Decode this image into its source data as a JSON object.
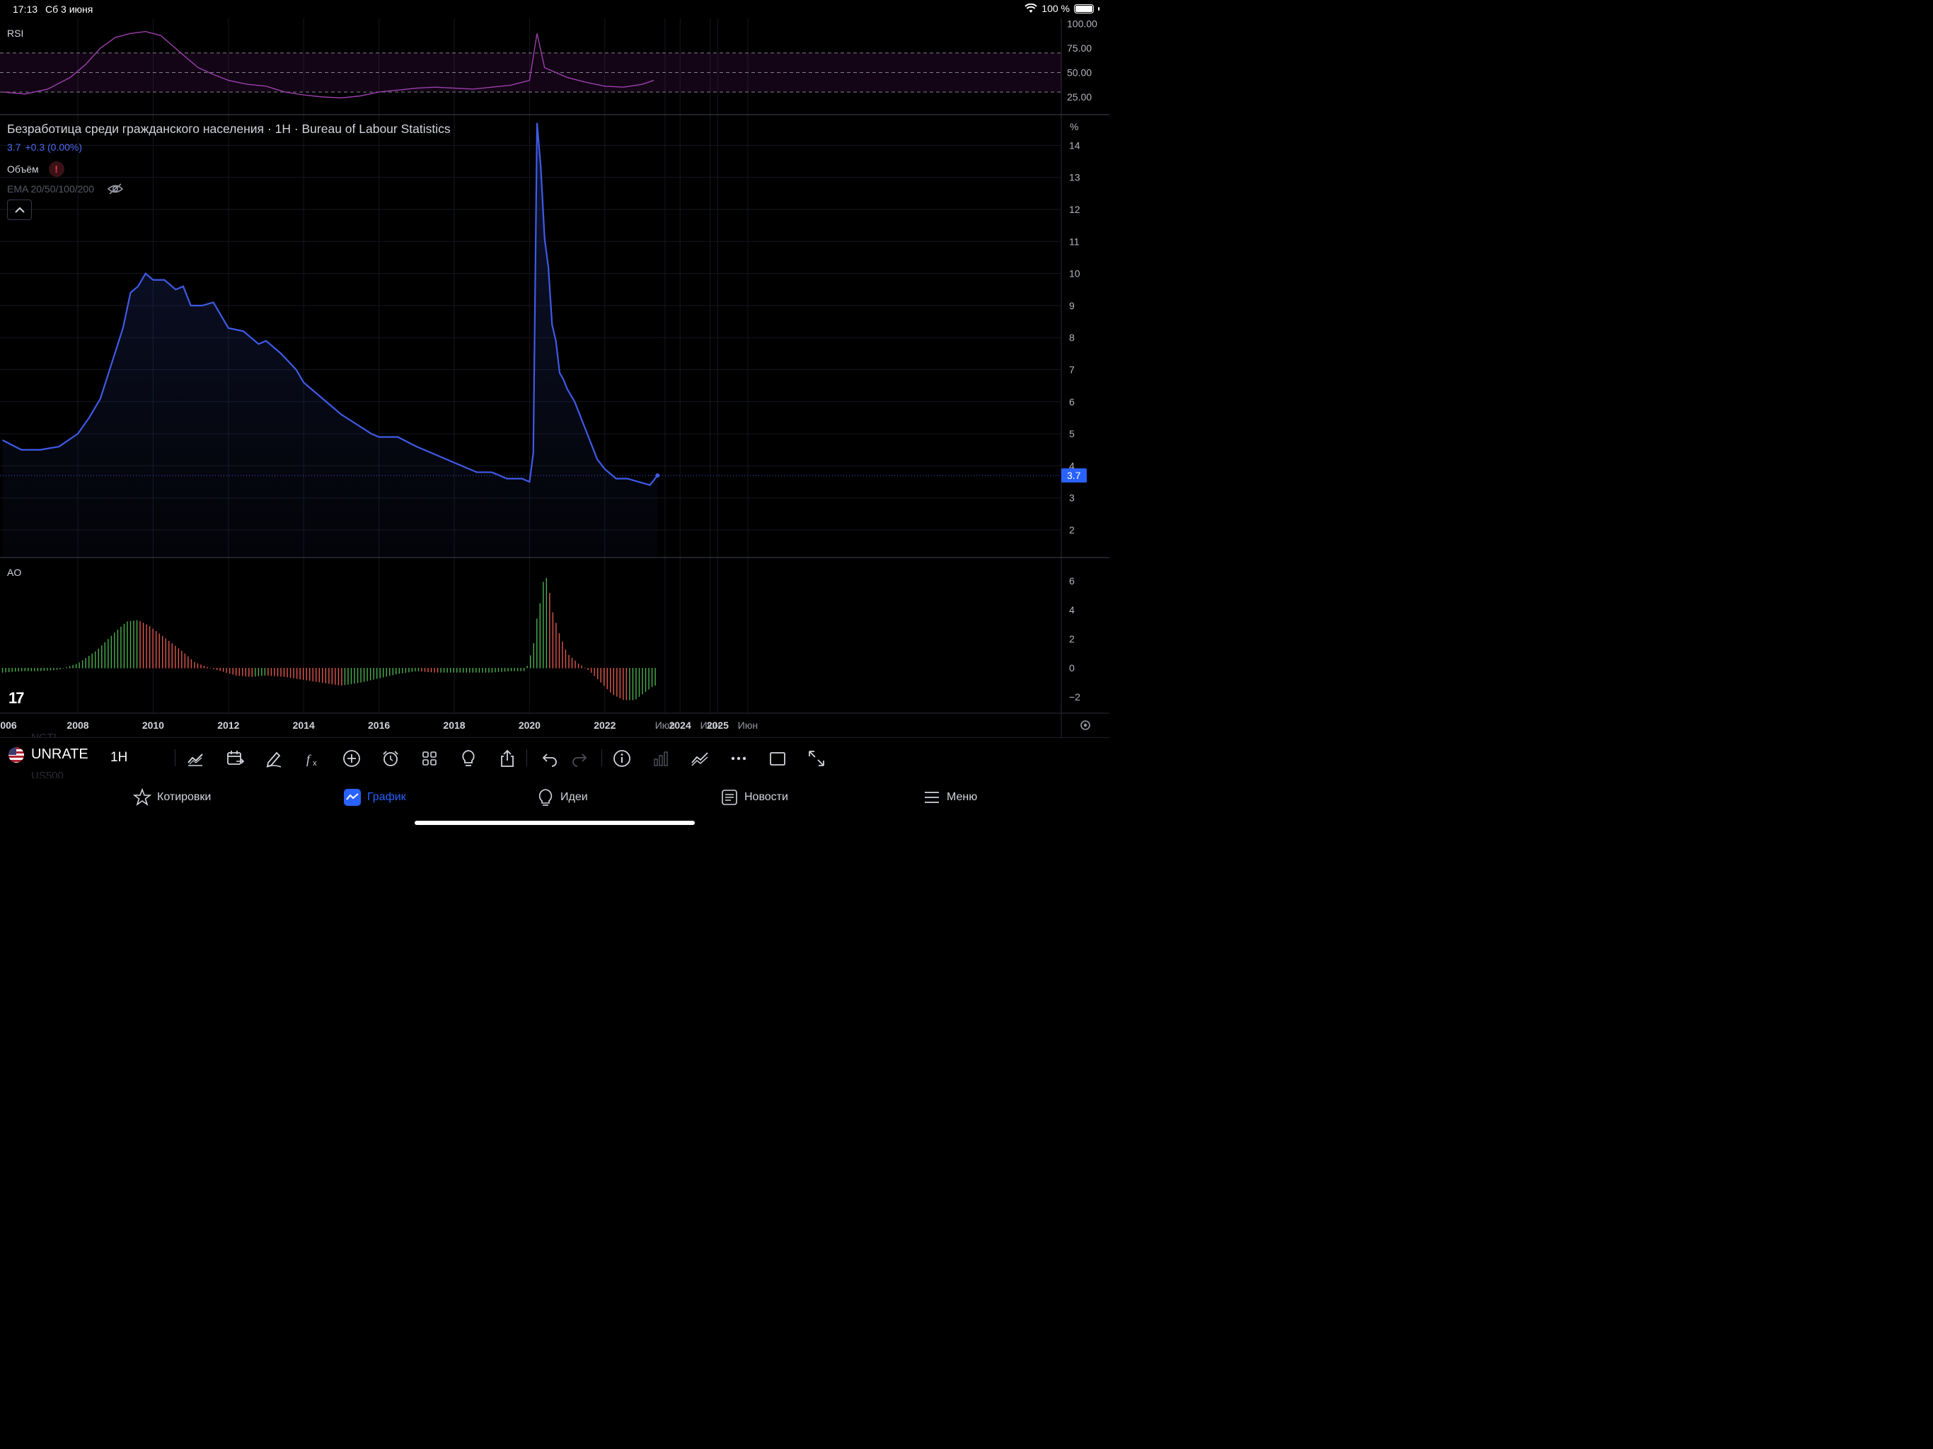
{
  "status_bar": {
    "time": "17:13",
    "date": "Сб 3 июня",
    "battery": "100 %"
  },
  "chart": {
    "title": "Безработица среди гражданского населения · 1Н · Bureau of Labour Statistics",
    "last_value": "3.7",
    "change": "+0.3 (0.00%)",
    "volume_label": "Объём",
    "ema_label": "EMA 20/50/100/200",
    "price_tag": "3.7",
    "unit": "%",
    "price_axis": [
      "14",
      "13",
      "12",
      "11",
      "10",
      "9",
      "8",
      "7",
      "6",
      "5",
      "4",
      "3",
      "2"
    ],
    "time_axis": [
      "006",
      "2008",
      "2010",
      "2012",
      "2014",
      "2016",
      "2018",
      "2020",
      "2022",
      "Июл",
      "2024",
      "Июн",
      "2025",
      "Июн"
    ],
    "rsi": {
      "label": "RSI",
      "axis": [
        "100.00",
        "75.00",
        "50.00",
        "25.00"
      ]
    },
    "ao": {
      "label": "AO",
      "axis": [
        "6",
        "4",
        "2",
        "0",
        "−2"
      ]
    },
    "colors": {
      "line": "#3f5be8",
      "rsi": "#9c3fae",
      "ao_up": "#4caf50",
      "ao_down": "#e0574e",
      "grid": "#14171f"
    }
  },
  "chart_data": [
    {
      "type": "area",
      "title": "Безработица среди гражданского населения · 1Н · Bureau of Labour Statistics",
      "ylabel": "%",
      "ylim": [
        1.2,
        14.7
      ],
      "x": [
        2006.0,
        2006.5,
        2007.0,
        2007.5,
        2008.0,
        2008.3,
        2008.6,
        2008.9,
        2009.2,
        2009.4,
        2009.6,
        2009.8,
        2010.0,
        2010.3,
        2010.6,
        2010.8,
        2011.0,
        2011.3,
        2011.6,
        2011.8,
        2012.0,
        2012.4,
        2012.8,
        2013.0,
        2013.4,
        2013.8,
        2014.0,
        2014.4,
        2014.8,
        2015.0,
        2015.4,
        2015.8,
        2016.0,
        2016.5,
        2017.0,
        2017.4,
        2017.8,
        2018.2,
        2018.6,
        2019.0,
        2019.4,
        2019.8,
        2020.0,
        2020.1,
        2020.2,
        2020.3,
        2020.4,
        2020.5,
        2020.6,
        2020.7,
        2020.8,
        2020.9,
        2021.0,
        2021.2,
        2021.4,
        2021.6,
        2021.8,
        2022.0,
        2022.3,
        2022.6,
        2022.9,
        2023.2,
        2023.4
      ],
      "y": [
        4.8,
        4.5,
        4.5,
        4.6,
        5.0,
        5.5,
        6.1,
        7.2,
        8.3,
        9.4,
        9.6,
        10.0,
        9.8,
        9.8,
        9.5,
        9.6,
        9.0,
        9.0,
        9.1,
        8.7,
        8.3,
        8.2,
        7.8,
        7.9,
        7.5,
        7.0,
        6.6,
        6.2,
        5.8,
        5.6,
        5.3,
        5.0,
        4.9,
        4.9,
        4.6,
        4.4,
        4.2,
        4.0,
        3.8,
        3.8,
        3.6,
        3.6,
        3.5,
        4.4,
        14.7,
        13.3,
        11.1,
        10.2,
        8.4,
        7.9,
        6.9,
        6.7,
        6.4,
        6.0,
        5.4,
        4.8,
        4.2,
        3.9,
        3.6,
        3.6,
        3.5,
        3.4,
        3.7
      ]
    },
    {
      "type": "line",
      "title": "RSI",
      "ylim": [
        0,
        100
      ],
      "x": [
        2006.0,
        2006.6,
        2007.2,
        2007.8,
        2008.2,
        2008.6,
        2009.0,
        2009.4,
        2009.8,
        2010.2,
        2010.5,
        2010.8,
        2011.2,
        2011.6,
        2012.0,
        2012.5,
        2013.0,
        2013.5,
        2014.0,
        2014.5,
        2015.0,
        2015.5,
        2016.0,
        2016.5,
        2017.0,
        2017.5,
        2018.0,
        2018.5,
        2019.0,
        2019.5,
        2020.0,
        2020.2,
        2020.4,
        2020.7,
        2021.0,
        2021.5,
        2022.0,
        2022.5,
        2023.0,
        2023.3
      ],
      "y": [
        30,
        28,
        33,
        45,
        58,
        75,
        86,
        90,
        92,
        88,
        78,
        68,
        55,
        48,
        42,
        38,
        36,
        30,
        27,
        25,
        24,
        26,
        30,
        32,
        34,
        35,
        34,
        33,
        35,
        37,
        42,
        90,
        55,
        50,
        45,
        40,
        36,
        35,
        38,
        42
      ]
    },
    {
      "type": "bar",
      "title": "AO",
      "ylim": [
        -2.5,
        6.5
      ],
      "x": [
        2006.0,
        2006.5,
        2007.0,
        2007.5,
        2008.0,
        2008.5,
        2009.0,
        2009.3,
        2009.6,
        2009.9,
        2010.2,
        2010.5,
        2010.8,
        2011.1,
        2011.4,
        2011.8,
        2012.2,
        2012.6,
        2013.0,
        2013.5,
        2014.0,
        2014.5,
        2015.0,
        2015.5,
        2016.0,
        2016.5,
        2017.0,
        2017.5,
        2018.0,
        2018.5,
        2019.0,
        2019.5,
        2019.9,
        2020.1,
        2020.2,
        2020.3,
        2020.4,
        2020.5,
        2020.6,
        2020.8,
        2021.0,
        2021.3,
        2021.6,
        2021.9,
        2022.2,
        2022.5,
        2022.8,
        2023.0,
        2023.3
      ],
      "y": [
        -0.3,
        -0.2,
        -0.2,
        -0.1,
        0.3,
        1.2,
        2.5,
        3.2,
        3.3,
        2.9,
        2.3,
        1.7,
        1.1,
        0.4,
        0.1,
        -0.2,
        -0.5,
        -0.6,
        -0.5,
        -0.6,
        -0.8,
        -1.0,
        -1.2,
        -1.0,
        -0.7,
        -0.4,
        -0.2,
        -0.3,
        -0.3,
        -0.3,
        -0.3,
        -0.2,
        -0.2,
        1.5,
        3.5,
        4.7,
        6.6,
        5.8,
        4.0,
        2.3,
        1.0,
        0.3,
        -0.2,
        -1.0,
        -1.8,
        -2.2,
        -2.2,
        -1.8,
        -1.2
      ]
    }
  ],
  "toolbar": {
    "symbol": "UNRATE",
    "interval": "1Н",
    "ghost_top": "NGT!",
    "ghost_bottom": "US500"
  },
  "tabs": [
    {
      "label": "Котировки",
      "icon": "star-icon"
    },
    {
      "label": "График",
      "icon": "chart-icon"
    },
    {
      "label": "Идеи",
      "icon": "bulb-icon"
    },
    {
      "label": "Новости",
      "icon": "news-icon"
    },
    {
      "label": "Меню",
      "icon": "menu-icon"
    }
  ]
}
